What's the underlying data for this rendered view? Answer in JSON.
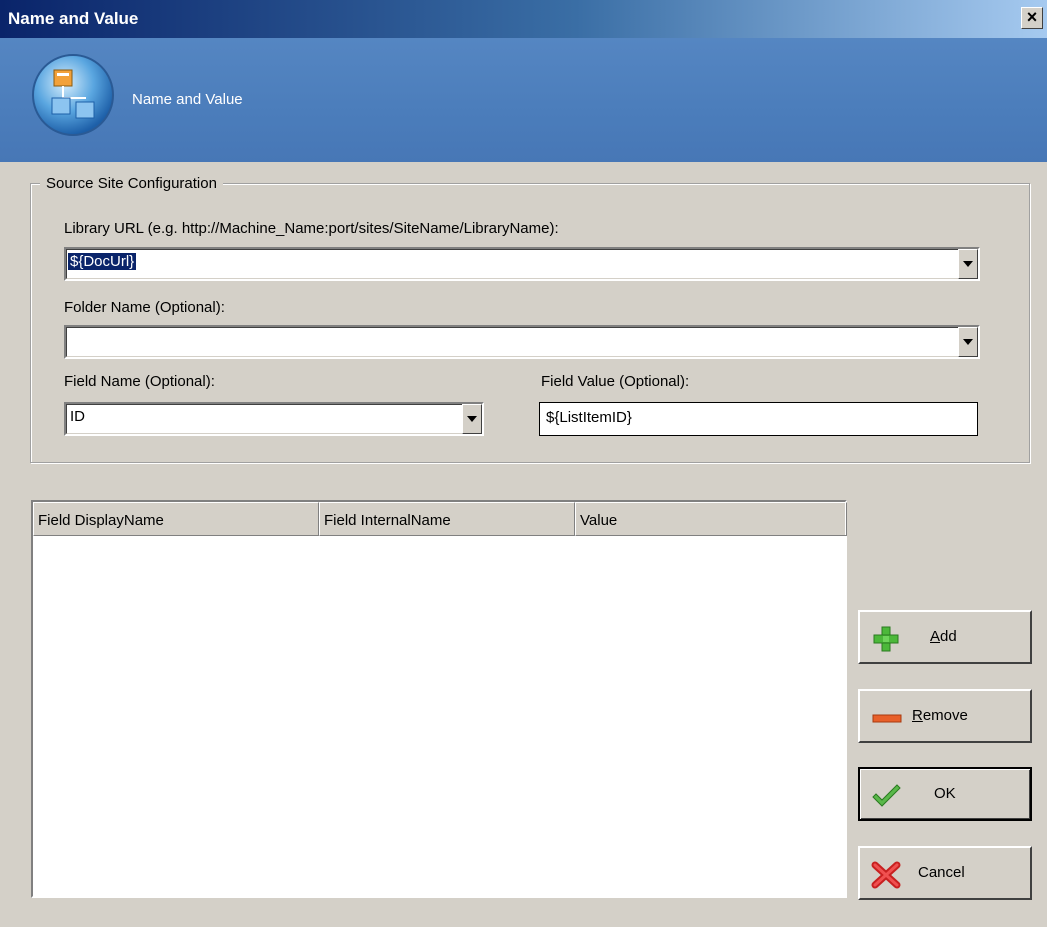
{
  "window": {
    "title": "Name and Value",
    "close_label": "×"
  },
  "banner": {
    "title": "Name and Value"
  },
  "group": {
    "legend": "Source Site Configuration",
    "library_url_label": "Library URL  (e.g.  http://Machine_Name:port/sites/SiteName/LibraryName):",
    "library_url_value": "${DocUrl}",
    "folder_label": "Folder Name (Optional):",
    "folder_value": "",
    "field_name_label": "Field Name (Optional):",
    "field_name_value": "ID",
    "field_value_label": "Field Value (Optional):",
    "field_value_value": "${ListItemID}"
  },
  "list": {
    "columns": [
      "Field DisplayName",
      "Field InternalName",
      "Value"
    ],
    "rows": []
  },
  "buttons": {
    "add": {
      "accel": "A",
      "rest": "dd"
    },
    "remove": {
      "accel": "R",
      "rest": "emove"
    },
    "ok": "OK",
    "cancel": "Cancel"
  }
}
